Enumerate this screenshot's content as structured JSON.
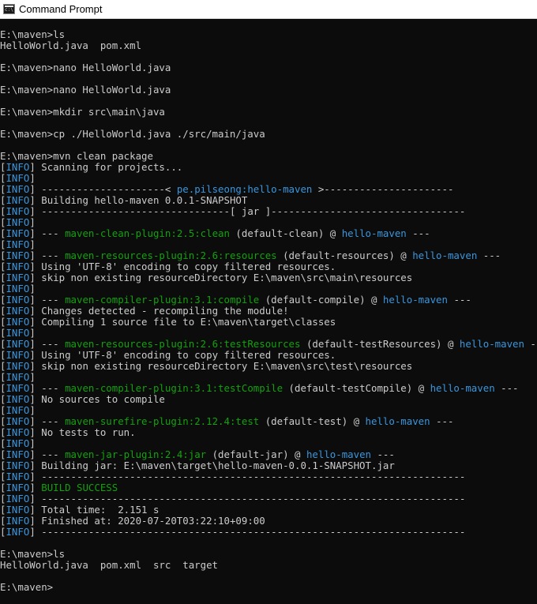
{
  "window": {
    "title": "Command Prompt"
  },
  "terminal": {
    "lines": [
      [
        [
          "E:\\maven>ls",
          "w"
        ]
      ],
      [
        [
          "HelloWorld.java  pom.xml",
          "w"
        ]
      ],
      [
        [
          "",
          "w"
        ]
      ],
      [
        [
          "E:\\maven>nano HelloWorld.java",
          "w"
        ]
      ],
      [
        [
          "",
          "w"
        ]
      ],
      [
        [
          "E:\\maven>nano HelloWorld.java",
          "w"
        ]
      ],
      [
        [
          "",
          "w"
        ]
      ],
      [
        [
          "E:\\maven>mkdir src\\main\\java",
          "w"
        ]
      ],
      [
        [
          "",
          "w"
        ]
      ],
      [
        [
          "E:\\maven>cp ./HelloWorld.java ./src/main/java",
          "w"
        ]
      ],
      [
        [
          "",
          "w"
        ]
      ],
      [
        [
          "E:\\maven>mvn clean package",
          "w"
        ]
      ],
      [
        [
          "[",
          "w"
        ],
        [
          "INFO",
          "c"
        ],
        [
          "] Scanning for projects...",
          "w"
        ]
      ],
      [
        [
          "[",
          "w"
        ],
        [
          "INFO",
          "c"
        ],
        [
          "]",
          "w"
        ]
      ],
      [
        [
          "[",
          "w"
        ],
        [
          "INFO",
          "c"
        ],
        [
          "] ---------------------< ",
          "w"
        ],
        [
          "pe.pilseong:hello-maven",
          "c"
        ],
        [
          " >----------------------",
          "w"
        ]
      ],
      [
        [
          "[",
          "w"
        ],
        [
          "INFO",
          "c"
        ],
        [
          "] Building hello-maven 0.0.1-SNAPSHOT",
          "w"
        ]
      ],
      [
        [
          "[",
          "w"
        ],
        [
          "INFO",
          "c"
        ],
        [
          "] --------------------------------[ jar ]---------------------------------",
          "w"
        ]
      ],
      [
        [
          "[",
          "w"
        ],
        [
          "INFO",
          "c"
        ],
        [
          "]",
          "w"
        ]
      ],
      [
        [
          "[",
          "w"
        ],
        [
          "INFO",
          "c"
        ],
        [
          "] --- ",
          "w"
        ],
        [
          "maven-clean-plugin:2.5:clean",
          "g"
        ],
        [
          " (default-clean) @ ",
          "w"
        ],
        [
          "hello-maven",
          "c"
        ],
        [
          " ---",
          "w"
        ]
      ],
      [
        [
          "[",
          "w"
        ],
        [
          "INFO",
          "c"
        ],
        [
          "]",
          "w"
        ]
      ],
      [
        [
          "[",
          "w"
        ],
        [
          "INFO",
          "c"
        ],
        [
          "] --- ",
          "w"
        ],
        [
          "maven-resources-plugin:2.6:resources",
          "g"
        ],
        [
          " (default-resources) @ ",
          "w"
        ],
        [
          "hello-maven",
          "c"
        ],
        [
          " ---",
          "w"
        ]
      ],
      [
        [
          "[",
          "w"
        ],
        [
          "INFO",
          "c"
        ],
        [
          "] Using 'UTF-8' encoding to copy filtered resources.",
          "w"
        ]
      ],
      [
        [
          "[",
          "w"
        ],
        [
          "INFO",
          "c"
        ],
        [
          "] skip non existing resourceDirectory E:\\maven\\src\\main\\resources",
          "w"
        ]
      ],
      [
        [
          "[",
          "w"
        ],
        [
          "INFO",
          "c"
        ],
        [
          "]",
          "w"
        ]
      ],
      [
        [
          "[",
          "w"
        ],
        [
          "INFO",
          "c"
        ],
        [
          "] --- ",
          "w"
        ],
        [
          "maven-compiler-plugin:3.1:compile",
          "g"
        ],
        [
          " (default-compile) @ ",
          "w"
        ],
        [
          "hello-maven",
          "c"
        ],
        [
          " ---",
          "w"
        ]
      ],
      [
        [
          "[",
          "w"
        ],
        [
          "INFO",
          "c"
        ],
        [
          "] Changes detected - recompiling the module!",
          "w"
        ]
      ],
      [
        [
          "[",
          "w"
        ],
        [
          "INFO",
          "c"
        ],
        [
          "] Compiling 1 source file to E:\\maven\\target\\classes",
          "w"
        ]
      ],
      [
        [
          "[",
          "w"
        ],
        [
          "INFO",
          "c"
        ],
        [
          "]",
          "w"
        ]
      ],
      [
        [
          "[",
          "w"
        ],
        [
          "INFO",
          "c"
        ],
        [
          "] --- ",
          "w"
        ],
        [
          "maven-resources-plugin:2.6:testResources",
          "g"
        ],
        [
          " (default-testResources) @ ",
          "w"
        ],
        [
          "hello-maven",
          "c"
        ],
        [
          " ---",
          "w"
        ]
      ],
      [
        [
          "[",
          "w"
        ],
        [
          "INFO",
          "c"
        ],
        [
          "] Using 'UTF-8' encoding to copy filtered resources.",
          "w"
        ]
      ],
      [
        [
          "[",
          "w"
        ],
        [
          "INFO",
          "c"
        ],
        [
          "] skip non existing resourceDirectory E:\\maven\\src\\test\\resources",
          "w"
        ]
      ],
      [
        [
          "[",
          "w"
        ],
        [
          "INFO",
          "c"
        ],
        [
          "]",
          "w"
        ]
      ],
      [
        [
          "[",
          "w"
        ],
        [
          "INFO",
          "c"
        ],
        [
          "] --- ",
          "w"
        ],
        [
          "maven-compiler-plugin:3.1:testCompile",
          "g"
        ],
        [
          " (default-testCompile) @ ",
          "w"
        ],
        [
          "hello-maven",
          "c"
        ],
        [
          " ---",
          "w"
        ]
      ],
      [
        [
          "[",
          "w"
        ],
        [
          "INFO",
          "c"
        ],
        [
          "] No sources to compile",
          "w"
        ]
      ],
      [
        [
          "[",
          "w"
        ],
        [
          "INFO",
          "c"
        ],
        [
          "]",
          "w"
        ]
      ],
      [
        [
          "[",
          "w"
        ],
        [
          "INFO",
          "c"
        ],
        [
          "] --- ",
          "w"
        ],
        [
          "maven-surefire-plugin:2.12.4:test",
          "g"
        ],
        [
          " (default-test) @ ",
          "w"
        ],
        [
          "hello-maven",
          "c"
        ],
        [
          " ---",
          "w"
        ]
      ],
      [
        [
          "[",
          "w"
        ],
        [
          "INFO",
          "c"
        ],
        [
          "] No tests to run.",
          "w"
        ]
      ],
      [
        [
          "[",
          "w"
        ],
        [
          "INFO",
          "c"
        ],
        [
          "]",
          "w"
        ]
      ],
      [
        [
          "[",
          "w"
        ],
        [
          "INFO",
          "c"
        ],
        [
          "] --- ",
          "w"
        ],
        [
          "maven-jar-plugin:2.4:jar",
          "g"
        ],
        [
          " (default-jar) @ ",
          "w"
        ],
        [
          "hello-maven",
          "c"
        ],
        [
          " ---",
          "w"
        ]
      ],
      [
        [
          "[",
          "w"
        ],
        [
          "INFO",
          "c"
        ],
        [
          "] Building jar: E:\\maven\\target\\hello-maven-0.0.1-SNAPSHOT.jar",
          "w"
        ]
      ],
      [
        [
          "[",
          "w"
        ],
        [
          "INFO",
          "c"
        ],
        [
          "] ------------------------------------------------------------------------",
          "w"
        ]
      ],
      [
        [
          "[",
          "w"
        ],
        [
          "INFO",
          "c"
        ],
        [
          "] ",
          "w"
        ],
        [
          "BUILD SUCCESS",
          "g"
        ]
      ],
      [
        [
          "[",
          "w"
        ],
        [
          "INFO",
          "c"
        ],
        [
          "] ------------------------------------------------------------------------",
          "w"
        ]
      ],
      [
        [
          "[",
          "w"
        ],
        [
          "INFO",
          "c"
        ],
        [
          "] Total time:  2.151 s",
          "w"
        ]
      ],
      [
        [
          "[",
          "w"
        ],
        [
          "INFO",
          "c"
        ],
        [
          "] Finished at: 2020-07-20T03:22:10+09:00",
          "w"
        ]
      ],
      [
        [
          "[",
          "w"
        ],
        [
          "INFO",
          "c"
        ],
        [
          "] ------------------------------------------------------------------------",
          "w"
        ]
      ],
      [
        [
          "",
          "w"
        ]
      ],
      [
        [
          "E:\\maven>ls",
          "w"
        ]
      ],
      [
        [
          "HelloWorld.java  pom.xml  src  target",
          "w"
        ]
      ],
      [
        [
          "",
          "w"
        ]
      ],
      [
        [
          "E:\\maven>",
          "w"
        ]
      ]
    ]
  },
  "colors": {
    "background": "#0c0c0c",
    "text": "#cccccc",
    "info": "#3a96dd",
    "plugin": "#13a10e"
  }
}
